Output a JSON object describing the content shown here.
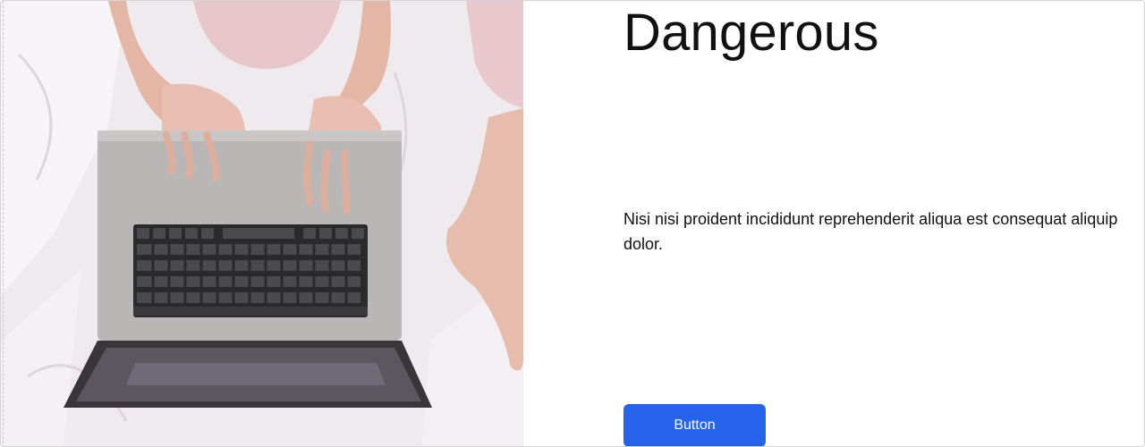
{
  "hero": {
    "image_icon": "photo-person-laptop-icon",
    "title": "Dangerous",
    "description": "Nisi nisi proident incididunt reprehenderit aliqua est consequat aliquip dolor.",
    "button_label": "Button"
  },
  "colors": {
    "button_bg": "#2563eb",
    "button_text": "#ffffff",
    "text": "#111111",
    "border": "#d4d4d4"
  }
}
